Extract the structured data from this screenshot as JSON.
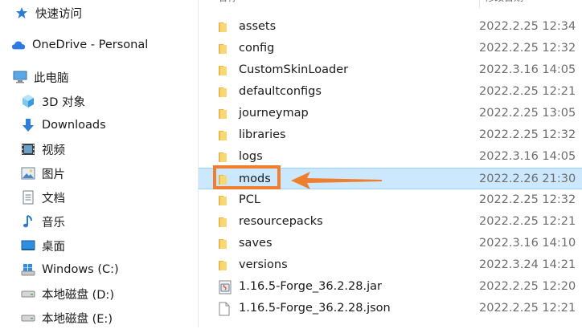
{
  "nav": {
    "quick_access": "快速访问",
    "onedrive": "OneDrive - Personal",
    "this_pc": "此电脑",
    "items": [
      {
        "label": "3D 对象",
        "icon": "3d-objects-icon"
      },
      {
        "label": "Downloads",
        "icon": "downloads-icon"
      },
      {
        "label": "视频",
        "icon": "videos-icon"
      },
      {
        "label": "图片",
        "icon": "pictures-icon"
      },
      {
        "label": "文档",
        "icon": "documents-icon"
      },
      {
        "label": "音乐",
        "icon": "music-icon"
      },
      {
        "label": "桌面",
        "icon": "desktop-icon"
      },
      {
        "label": "Windows (C:)",
        "icon": "windows-drive-icon"
      },
      {
        "label": "本地磁盘 (D:)",
        "icon": "drive-icon"
      },
      {
        "label": "本地磁盘 (E:)",
        "icon": "drive-icon"
      }
    ]
  },
  "header": {
    "name": "名称",
    "date": "修改日期"
  },
  "files": [
    {
      "name": "assets",
      "date": "2022.2.25 12:34",
      "type": "folder"
    },
    {
      "name": "config",
      "date": "2022.2.25 12:32",
      "type": "folder"
    },
    {
      "name": "CustomSkinLoader",
      "date": "2022.3.16 14:05",
      "type": "folder"
    },
    {
      "name": "defaultconfigs",
      "date": "2022.2.25 12:21",
      "type": "folder"
    },
    {
      "name": "journeymap",
      "date": "2022.2.25 13:05",
      "type": "folder"
    },
    {
      "name": "libraries",
      "date": "2022.2.25 12:32",
      "type": "folder"
    },
    {
      "name": "logs",
      "date": "2022.3.16 14:05",
      "type": "folder"
    },
    {
      "name": "mods",
      "date": "2022.2.26 21:30",
      "type": "folder",
      "selected": true
    },
    {
      "name": "PCL",
      "date": "2022.2.25 12:32",
      "type": "folder"
    },
    {
      "name": "resourcepacks",
      "date": "2022.2.25 12:21",
      "type": "folder"
    },
    {
      "name": "saves",
      "date": "2022.3.16 14:10",
      "type": "folder"
    },
    {
      "name": "versions",
      "date": "2022.3.24 14:21",
      "type": "folder"
    },
    {
      "name": "1.16.5-Forge_36.2.28.jar",
      "date": "2022.2.25 12:20",
      "type": "jar"
    },
    {
      "name": "1.16.5-Forge_36.2.28.json",
      "date": "2022.2.25 12:21",
      "type": "file"
    }
  ],
  "colors": {
    "folder": "#f8d775",
    "selection": "#cce8ff",
    "annotation": "#ef7e2e"
  }
}
